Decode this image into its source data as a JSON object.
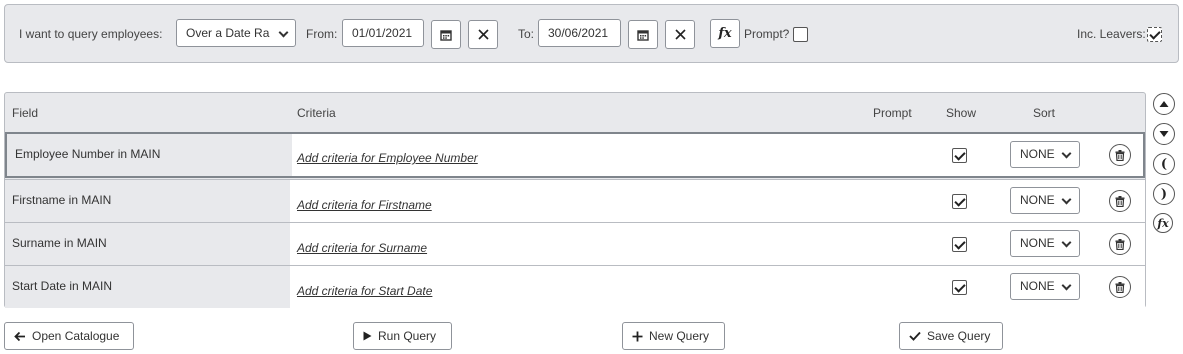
{
  "query_bar": {
    "intro_label": "I want to query employees:",
    "mode_value": "Over a Date Ra",
    "from_label": "From:",
    "from_value": "01/01/2021",
    "to_label": "To:",
    "to_value": "30/06/2021",
    "prompt_label": "Prompt?",
    "prompt_checked": false,
    "leavers_label": "Inc. Leavers:",
    "leavers_checked": true
  },
  "grid": {
    "headers": {
      "field": "Field",
      "criteria": "Criteria",
      "prompt": "Prompt",
      "show": "Show",
      "sort": "Sort"
    },
    "rows": [
      {
        "field": "Employee Number in MAIN",
        "criteria": "Add criteria for Employee Number",
        "show": true,
        "sort": "NONE",
        "selected": true
      },
      {
        "field": "Firstname in MAIN",
        "criteria": "Add criteria for Firstname",
        "show": true,
        "sort": "NONE",
        "selected": false
      },
      {
        "field": "Surname in MAIN",
        "criteria": "Add criteria for Surname",
        "show": true,
        "sort": "NONE",
        "selected": false
      },
      {
        "field": "Start Date in MAIN",
        "criteria": "Add criteria for Start Date",
        "show": true,
        "sort": "NONE",
        "selected": false
      }
    ]
  },
  "side_tools": {
    "open_paren": "(",
    "close_paren": ")"
  },
  "fx_symbol": "fx",
  "buttons": {
    "open_catalogue": "Open Catalogue",
    "run_query": "Run Query",
    "new_query": "New Query",
    "save_query": "Save Query"
  }
}
